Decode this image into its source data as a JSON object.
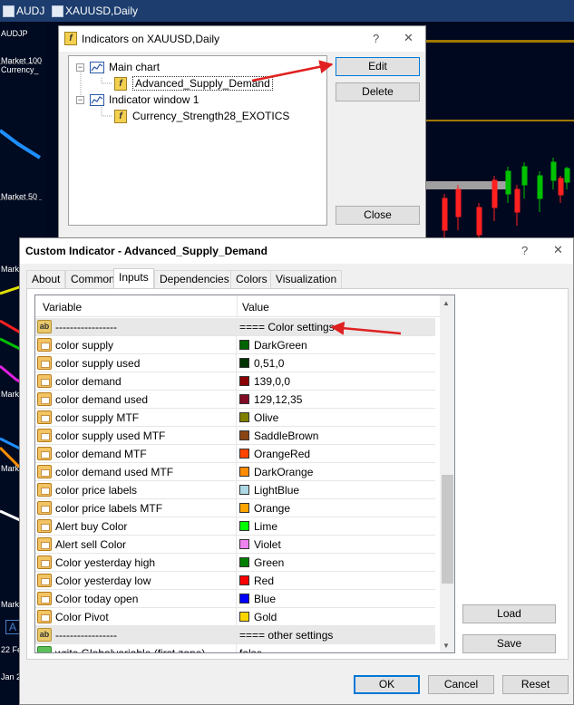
{
  "background": {
    "tabs": [
      {
        "label": "AUDJ"
      },
      {
        "label": "XAUUSD,Daily"
      }
    ],
    "left_labels": [
      "AUDJP",
      "Market 100",
      "Currency_",
      "Market 50",
      "Mark",
      "22 Fe",
      "Jan 20",
      "A"
    ]
  },
  "indicators_dialog": {
    "title": "Indicators on XAUUSD,Daily",
    "help_glyph": "?",
    "close_glyph": "✕",
    "tree": {
      "main_chart": "Main chart",
      "main_items": [
        "Advanced_Supply_Demand"
      ],
      "window1": "Indicator window 1",
      "window1_items": [
        "Currency_Strength28_EXOTICS"
      ]
    },
    "buttons": {
      "edit": "Edit",
      "delete": "Delete",
      "close": "Close"
    }
  },
  "custom_dialog": {
    "title": "Custom Indicator - Advanced_Supply_Demand",
    "help_glyph": "?",
    "close_glyph": "✕",
    "tabs": [
      "About",
      "Common",
      "Inputs",
      "Dependencies",
      "Colors",
      "Visualization"
    ],
    "active_tab": "Inputs",
    "grid": {
      "col_variable": "Variable",
      "col_value": "Value",
      "rows": [
        {
          "type": "ab",
          "variable": "-----------------",
          "value": "==== Color settings"
        },
        {
          "type": "color",
          "variable": "color supply",
          "value": "DarkGreen",
          "swatch": "#006400"
        },
        {
          "type": "color",
          "variable": "color supply used",
          "value": "0,51,0",
          "swatch": "#003300"
        },
        {
          "type": "color",
          "variable": "color demand",
          "value": "139,0,0",
          "swatch": "#8b0000"
        },
        {
          "type": "color",
          "variable": "color demand used",
          "value": "129,12,35",
          "swatch": "#810c23"
        },
        {
          "type": "color",
          "variable": "color supply MTF",
          "value": "Olive",
          "swatch": "#808000"
        },
        {
          "type": "color",
          "variable": "color supply used MTF",
          "value": "SaddleBrown",
          "swatch": "#8b4513"
        },
        {
          "type": "color",
          "variable": "color demand MTF",
          "value": "OrangeRed",
          "swatch": "#ff4500"
        },
        {
          "type": "color",
          "variable": "color demand used MTF",
          "value": "DarkOrange",
          "swatch": "#ff8c00"
        },
        {
          "type": "color",
          "variable": "color price labels",
          "value": "LightBlue",
          "swatch": "#add8e6"
        },
        {
          "type": "color",
          "variable": "color price labels MTF",
          "value": "Orange",
          "swatch": "#ffa500"
        },
        {
          "type": "color",
          "variable": "Alert buy Color",
          "value": "Lime",
          "swatch": "#00ff00"
        },
        {
          "type": "color",
          "variable": "Alert sell Color",
          "value": "Violet",
          "swatch": "#ee82ee"
        },
        {
          "type": "color",
          "variable": "Color yesterday high",
          "value": "Green",
          "swatch": "#008000"
        },
        {
          "type": "color",
          "variable": "Color yesterday low",
          "value": "Red",
          "swatch": "#ff0000"
        },
        {
          "type": "color",
          "variable": "Color today open",
          "value": "Blue",
          "swatch": "#0000ff"
        },
        {
          "type": "color",
          "variable": "Color Pivot",
          "value": "Gold",
          "swatch": "#ffd700"
        },
        {
          "type": "ab",
          "variable": "-----------------",
          "value": "==== other settings"
        },
        {
          "type": "bool",
          "variable": "write Globalvariable (first zone)",
          "value": "false"
        }
      ]
    },
    "buttons": {
      "load": "Load",
      "save": "Save",
      "ok": "OK",
      "cancel": "Cancel",
      "reset": "Reset"
    }
  },
  "colors": {
    "arrow": "#e02020",
    "focus": "#0078d7"
  }
}
